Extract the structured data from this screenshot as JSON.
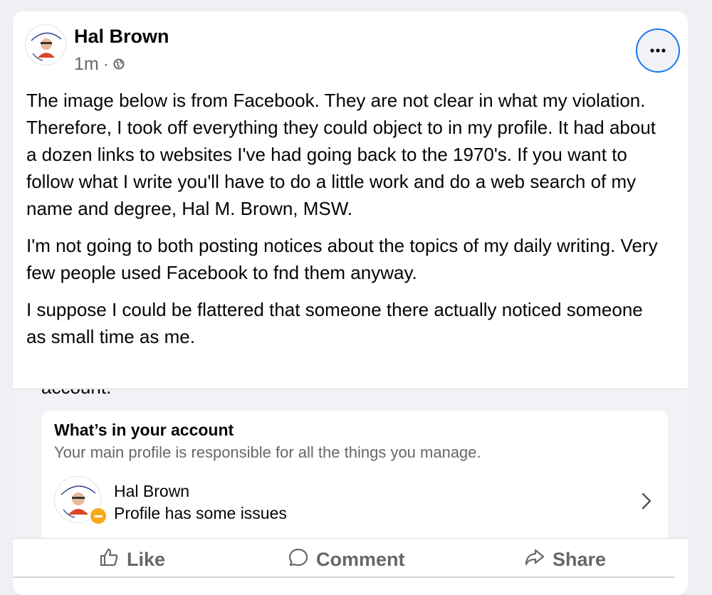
{
  "post": {
    "author": "Hal Brown",
    "time": "1m",
    "separator": "·",
    "audience_icon": "globe-icon",
    "more_icon": "more-dots-icon",
    "paragraphs": [
      "The image below is from Facebook. They are not clear in what my violation. Therefore, I took off everything they could object to in my profile. It had about a dozen links to websites I've had going back to the 1970's. If you want to follow what I write you'll have to do a little work and do a web search of my name and degree, Hal M. Brown, MSW.",
      "I'm not going to both posting notices about the topics of my daily writing. Very few people used Facebook to fnd them anyway.",
      "I suppose I could be flattered that someone there actually noticed someone as small time as me."
    ]
  },
  "shared_image": {
    "cut_off_text": "account.",
    "card_title": "What’s in your account",
    "card_subtitle": "Your main profile is responsible for all the things you manage.",
    "profile_name": "Hal Brown",
    "profile_status": "Profile has some issues",
    "status_color": "#f7a81b"
  },
  "actions": {
    "like": "Like",
    "comment": "Comment",
    "share": "Share"
  },
  "colors": {
    "accent": "#1877f2",
    "secondary_text": "#65676b",
    "background": "#eef0f3"
  }
}
